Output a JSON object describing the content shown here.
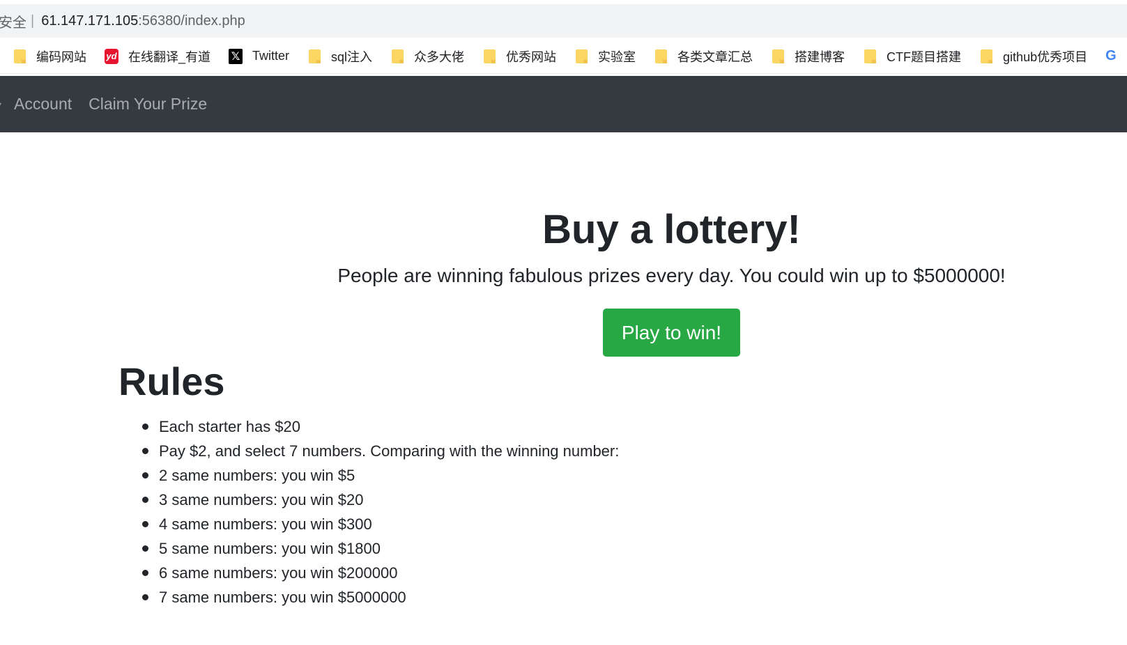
{
  "browser": {
    "address": {
      "security_label": "安全",
      "separator": "|",
      "host": "61.147.171.105",
      "path": ":56380/index.php"
    },
    "bookmarks": [
      {
        "label": "编码网站",
        "icon": "folder-icon"
      },
      {
        "label": "在线翻译_有道",
        "icon": "youdao-icon"
      },
      {
        "label": "Twitter",
        "icon": "x-icon"
      },
      {
        "label": "sql注入",
        "icon": "folder-icon"
      },
      {
        "label": "众多大佬",
        "icon": "folder-icon"
      },
      {
        "label": "优秀网站",
        "icon": "folder-icon"
      },
      {
        "label": "实验室",
        "icon": "folder-icon"
      },
      {
        "label": "各类文章汇总",
        "icon": "folder-icon"
      },
      {
        "label": "搭建博客",
        "icon": "folder-icon"
      },
      {
        "label": "CTF题目搭建",
        "icon": "folder-icon"
      },
      {
        "label": "github优秀项目",
        "icon": "folder-icon"
      }
    ],
    "icons": {
      "youdao_text": "yd",
      "x_text": "𝕏",
      "google_text": "G"
    }
  },
  "navbar": {
    "background": "#343a40",
    "links": [
      {
        "label": "Account"
      },
      {
        "label": "Claim Your Prize"
      }
    ]
  },
  "hero": {
    "title": "Buy a lottery!",
    "lead": "People are winning fabulous prizes every day. You could win up to $5000000!",
    "button_label": "Play to win!",
    "button_color": "#28a745"
  },
  "rules": {
    "title": "Rules",
    "items": [
      "Each starter has $20",
      "Pay $2, and select 7 numbers. Comparing with the winning number:",
      "2 same numbers: you win $5",
      "3 same numbers: you win $20",
      "4 same numbers: you win $300",
      "5 same numbers: you win $1800",
      "6 same numbers: you win $200000",
      "7 same numbers: you win $5000000"
    ]
  }
}
